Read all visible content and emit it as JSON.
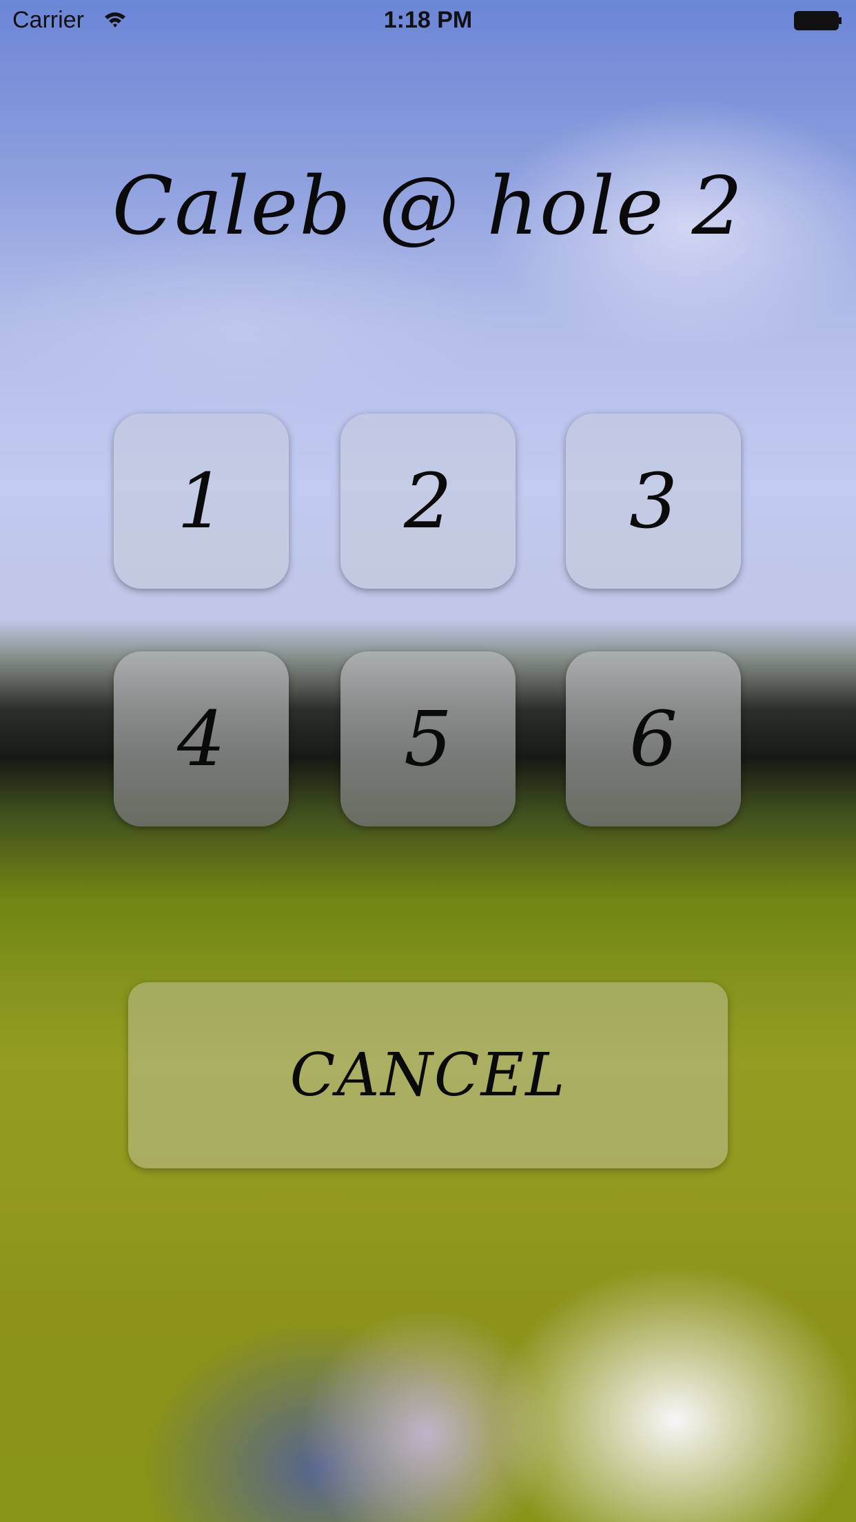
{
  "status_bar": {
    "carrier": "Carrier",
    "time": "1:18 PM",
    "wifi_icon": "wifi-icon",
    "battery_icon": "battery-icon"
  },
  "title": "Caleb @ hole 2",
  "keypad": {
    "keys": [
      "1",
      "2",
      "3",
      "4",
      "5",
      "6"
    ]
  },
  "cancel_label": "CANCEL"
}
